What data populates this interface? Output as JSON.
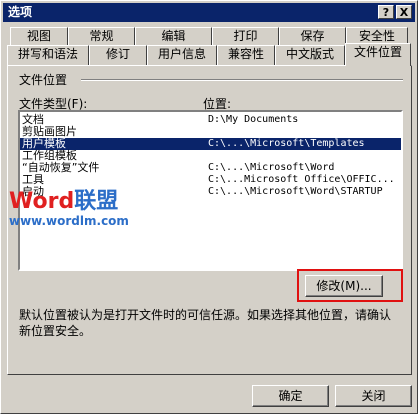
{
  "window": {
    "title": "选项"
  },
  "titlebar_buttons": {
    "help": "?",
    "close": "X"
  },
  "tabs_row1": [
    {
      "label": "视图"
    },
    {
      "label": "常规"
    },
    {
      "label": "编辑"
    },
    {
      "label": "打印"
    },
    {
      "label": "保存"
    },
    {
      "label": "安全性"
    }
  ],
  "tabs_row2": [
    {
      "label": "拼写和语法"
    },
    {
      "label": "修订"
    },
    {
      "label": "用户信息"
    },
    {
      "label": "兼容性"
    },
    {
      "label": "中文版式"
    },
    {
      "label": "文件位置",
      "active": true
    }
  ],
  "section": {
    "title": "文件位置"
  },
  "columns": {
    "type_header": "文件类型(F):",
    "location_header": "位置:"
  },
  "file_locations": [
    {
      "type": "文档",
      "location": "D:\\My Documents"
    },
    {
      "type": "剪贴画图片",
      "location": ""
    },
    {
      "type": "用户模板",
      "location": "C:\\...\\Microsoft\\Templates",
      "selected": true
    },
    {
      "type": "工作组模板",
      "location": ""
    },
    {
      "type": "“自动恢复”文件",
      "location": "C:\\...\\Microsoft\\Word"
    },
    {
      "type": "工具",
      "location": "C:\\...Microsoft Office\\OFFIC..."
    },
    {
      "type": "启动",
      "location": "C:\\...\\Microsoft\\Word\\STARTUP"
    }
  ],
  "watermark": {
    "logo_word": "Word",
    "logo_cn": "联盟",
    "url": "www.wordlm.com"
  },
  "buttons": {
    "modify": "修改(M)...",
    "ok": "确定",
    "cancel": "关闭"
  },
  "footnote": "默认位置被认为是打开文件时的可信任源。如果选择其他位置，请确认新位置安全。",
  "colors": {
    "titlebar": "#0a246a",
    "highlight_box": "#e01010",
    "selection": "#0a246a",
    "watermark_red": "#e02020",
    "watermark_blue": "#2c6ec8"
  }
}
